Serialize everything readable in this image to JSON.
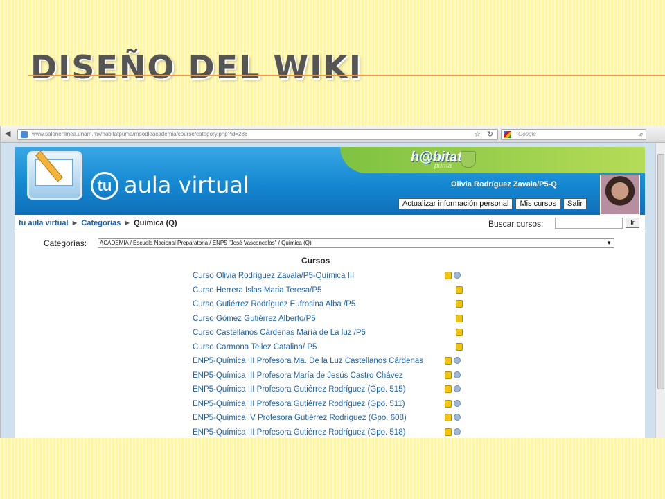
{
  "slide": {
    "title": "DISEÑO DEL WIKI"
  },
  "browser": {
    "url": "www.salonenlinea.unam.mx/habitatpuma/moodleacademia/course/category.php?id=286",
    "search_placeholder": "Google"
  },
  "header": {
    "logo_tu": "tu",
    "logo_text": "aula virtual",
    "brand": "h@bitat",
    "brand_sub": "puma",
    "user_name": "Olivia Rodríguez Zavala/P5-Q",
    "buttons": [
      "Actualizar información personal",
      "Mis cursos",
      "Salir"
    ]
  },
  "breadcrumb": [
    "tu aula virtual",
    "Categorías",
    "Química (Q)"
  ],
  "search": {
    "label": "Buscar cursos:",
    "button": "Ir"
  },
  "category": {
    "label": "Categorías:",
    "selected": "ACADEMIA / Escuela Nacional Preparatoria / ENP5 \"José Vasconcelos\" / Química (Q)"
  },
  "courses": {
    "heading": "Cursos",
    "items": [
      {
        "name": "Curso Olivia Rodríguez Zavala/P5-Química III",
        "info": true
      },
      {
        "name": "Curso Herrera Islas Maria Teresa/P5",
        "info": false
      },
      {
        "name": "Curso Gutiérrez Rodríguez Eufrosina Alba /P5",
        "info": false
      },
      {
        "name": "Curso Gómez Gutiérrez Alberto/P5",
        "info": false
      },
      {
        "name": "Curso Castellanos Cárdenas María de La luz /P5",
        "info": false
      },
      {
        "name": "Curso Carmona Tellez Catalina/ P5",
        "info": false
      },
      {
        "name": "ENP5-Química III Profesora Ma. De la Luz Castellanos Cárdenas",
        "info": true
      },
      {
        "name": "ENP5-Química III Profesora María de Jesús Castro Chávez",
        "info": true
      },
      {
        "name": "ENP5-Química III Profesora Gutiérrez Rodríguez (Gpo. 515)",
        "info": true
      },
      {
        "name": "ENP5-Química III Profesora Gutiérrez Rodríguez (Gpo. 511)",
        "info": true
      },
      {
        "name": "ENP5-Química IV Profesora Gutiérrez Rodríguez (Gpo. 608)",
        "info": true
      },
      {
        "name": "ENP5-Química III Profesora Gutiérrez Rodríguez (Gpo. 518)",
        "info": true
      }
    ]
  },
  "colors": {
    "link": "#1b63a9",
    "banner": "#1588d2",
    "accent_green": "#7fc241",
    "title_rule": "#e89a4a"
  }
}
